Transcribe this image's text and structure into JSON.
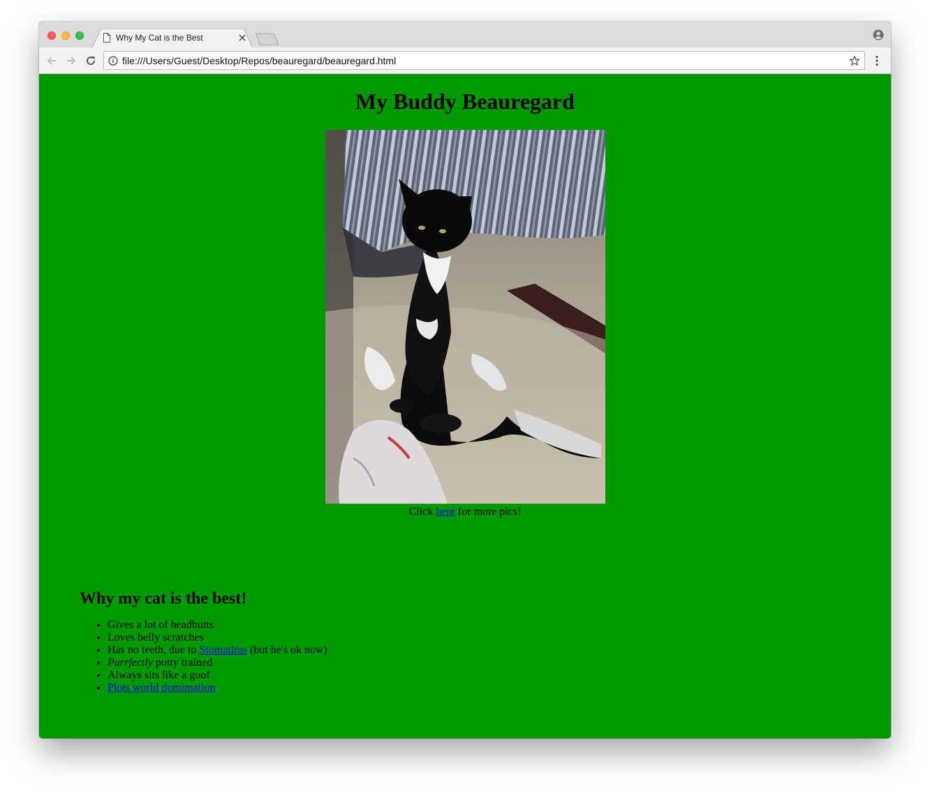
{
  "browser": {
    "tab_title": "Why My Cat is the Best",
    "url": "file:///Users/Guest/Desktop/Repos/beauregard/beauregard.html"
  },
  "page": {
    "background_color": "#009900",
    "title": "My Buddy Beauregard",
    "photo_alt": "Black and white cat sitting upright on a rug",
    "caption": {
      "before": "Click ",
      "link": "here",
      "after": " for more pics!"
    },
    "section_heading": "Why my cat is the best!",
    "reasons": {
      "r1": "Gives a lot of headbutts",
      "r2": "Loves belly scratches",
      "r3_before": "Has no teeth, due to ",
      "r3_link": "Stomatitus",
      "r3_after": " (but he's ok now)",
      "r4_em": "Purrfectly",
      "r4_after": " potty trained",
      "r5": "Always sits like a goof",
      "r6_link": "Plots world domimation"
    }
  },
  "icons": {
    "close": "close-icon",
    "back": "back-arrow-icon",
    "forward": "forward-arrow-icon",
    "reload": "reload-icon",
    "info": "info-icon",
    "bookmark": "star-icon",
    "menu": "three-dot-menu-icon",
    "profile": "profile-icon"
  }
}
